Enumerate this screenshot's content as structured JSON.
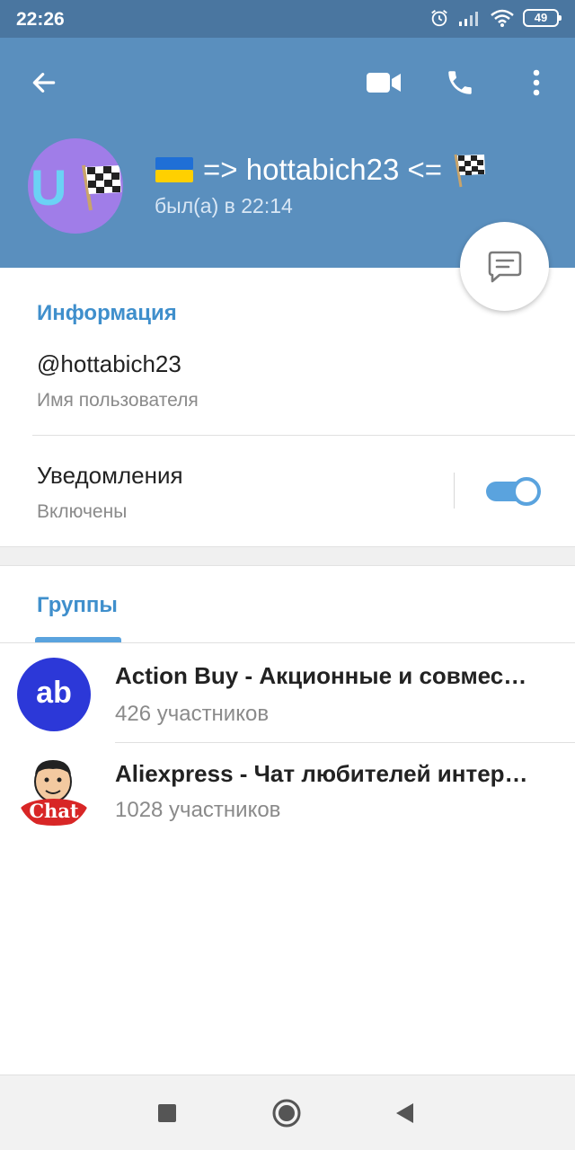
{
  "statusbar": {
    "time": "22:26",
    "battery": "49"
  },
  "header": {
    "name_prefix": "=> hottabich23 <=",
    "status": "был(а) в 22:14",
    "avatar_letter": "U"
  },
  "info": {
    "section_title": "Информация",
    "username": "@hottabich23",
    "username_label": "Имя пользователя",
    "notifications_label": "Уведомления",
    "notifications_state": "Включены",
    "notifications_on": true
  },
  "groups": {
    "tab_label": "Группы",
    "items": [
      {
        "name": "Action Buy - Акционные и совмес…",
        "members": "426 участников",
        "avatar_text": "ab"
      },
      {
        "name": "Aliexpress - Чат любителей интер…",
        "members": "1028 участников",
        "avatar_text": "Chat"
      }
    ]
  },
  "colors": {
    "statusbar": "#4a76a0",
    "header": "#5a8fbe",
    "accent": "#3f8fcc",
    "toggle": "#5aa3de"
  },
  "icons": [
    "back-arrow-icon",
    "video-icon",
    "phone-icon",
    "more-vertical-icon",
    "message-icon",
    "alarm-icon",
    "signal-icon",
    "wifi-icon",
    "battery-icon",
    "square-icon",
    "circle-icon",
    "triangle-back-icon"
  ]
}
